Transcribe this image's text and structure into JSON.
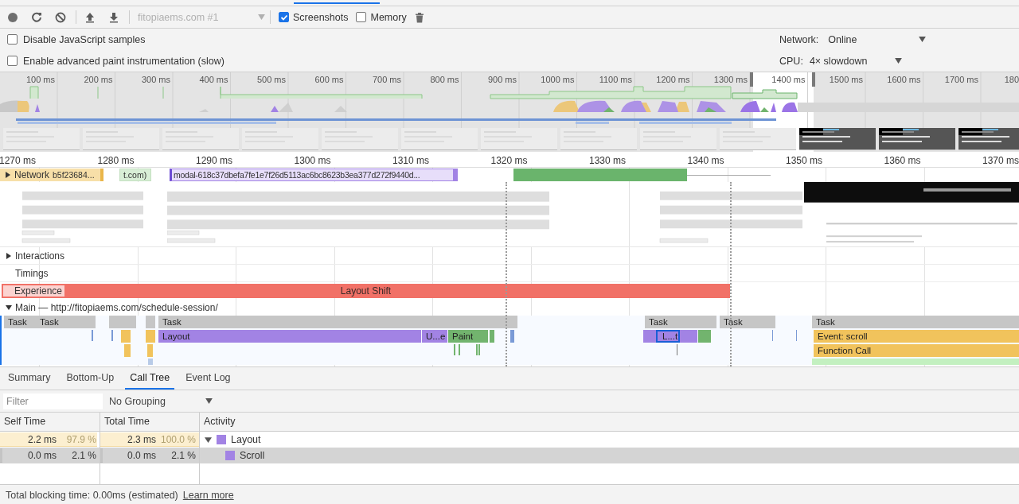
{
  "toolbar": {
    "profile_select": "fitopiaems.com #1",
    "checkboxes": [
      {
        "label": "Screenshots",
        "checked": true
      },
      {
        "label": "Memory",
        "checked": false
      }
    ]
  },
  "settings": [
    {
      "label": "Disable JavaScript samples",
      "checked": false
    },
    {
      "label": "Enable advanced paint instrumentation (slow)",
      "checked": false
    }
  ],
  "throttling": [
    {
      "label": "Network:",
      "value": "Online"
    },
    {
      "label": "CPU:",
      "value": "4× slowdown"
    }
  ],
  "overview": {
    "ticks": [
      "100 ms",
      "200 ms",
      "300 ms",
      "400 ms",
      "500 ms",
      "600 ms",
      "700 ms",
      "800 ms",
      "900 ms",
      "1000 ms",
      "1100 ms",
      "1200 ms",
      "1300 ms",
      "1400 ms",
      "1500 ms",
      "1600 ms",
      "1700 ms",
      "180"
    ]
  },
  "ruler": {
    "ticks": [
      "1270 ms",
      "1280 ms",
      "1290 ms",
      "1300 ms",
      "1310 ms",
      "1320 ms",
      "1330 ms",
      "1340 ms",
      "1350 ms",
      "1360 ms",
      "1370 ms"
    ]
  },
  "network": {
    "label": "Network",
    "expanded": false,
    "requests": [
      {
        "label": "b5f23684...",
        "color": "#f7dfa8"
      },
      {
        "label": "t.com)",
        "color": "#d8eed6"
      },
      {
        "label": "modal-618c37dbefa7fe1e7f26d5113ac6bc8623b3ea377d272f9440d...",
        "color": "#e7defa"
      },
      {
        "color": "#6ab46c"
      }
    ]
  },
  "tracks": [
    {
      "label": "Interactions",
      "expanded": false
    },
    {
      "label": "Timings"
    }
  ],
  "experience": {
    "label": "Experience",
    "shift": "Layout Shift"
  },
  "main": {
    "title": "Main — http://fitopiaems.com/schedule-session/",
    "expanded": true,
    "entries": [
      {
        "label": "Task",
        "color": "#c6c6c6",
        "selected": false
      },
      {
        "label": "Task",
        "color": "#c6c6c6",
        "selected": false
      },
      {
        "label": "Task",
        "color": "#c6c6c6",
        "selected": false
      },
      {
        "label": "Task",
        "color": "#c6c6c6",
        "selected": false
      },
      {
        "label": "Task",
        "color": "#c6c6c6",
        "selected": false
      },
      {
        "label": "Task",
        "color": "#c6c6c6",
        "selected": false
      },
      {
        "label": "Layout",
        "color": "#a283e4",
        "selected": false
      },
      {
        "label": "U...e",
        "color": "#a283e4",
        "selected": false
      },
      {
        "label": "Paint",
        "color": "#72b46e",
        "selected": false
      },
      {
        "label": "L...t",
        "color": "#a283e4",
        "selected": true
      },
      {
        "label": "Event: scroll",
        "color": "#f1c35c",
        "selected": false
      },
      {
        "label": "Function Call",
        "color": "#f1c35c",
        "selected": false
      }
    ]
  },
  "details": {
    "tabs": [
      {
        "label": "Summary",
        "selected": false
      },
      {
        "label": "Bottom-Up",
        "selected": false
      },
      {
        "label": "Call Tree",
        "selected": true
      },
      {
        "label": "Event Log",
        "selected": false
      }
    ],
    "filter": {
      "placeholder": "Filter"
    },
    "grouping": "No Grouping",
    "columns": [
      "Self Time",
      "Total Time",
      "Activity"
    ],
    "rows": [
      {
        "self": "2.2 ms",
        "self_pct": "97.9 %",
        "self_bar": {
          "level": 0.979
        },
        "total": "2.3 ms",
        "total_pct": "100.0 %",
        "total_bar": {
          "level": 1.0
        },
        "activity": "Layout",
        "color": "#a283e4",
        "expanded": true,
        "selected": false,
        "children": [
          {
            "self": "0.0 ms",
            "self_pct": "2.1 %",
            "self_bar": {
              "level": 0.021
            },
            "total": "0.0 ms",
            "total_pct": "2.1 %",
            "total_bar": {
              "level": 0.021
            },
            "activity": "Scroll",
            "color": "#a283e4",
            "selected": true
          }
        ]
      }
    ]
  },
  "status": {
    "text": "Total blocking time: 0.00ms (estimated)",
    "link": "Learn more"
  }
}
